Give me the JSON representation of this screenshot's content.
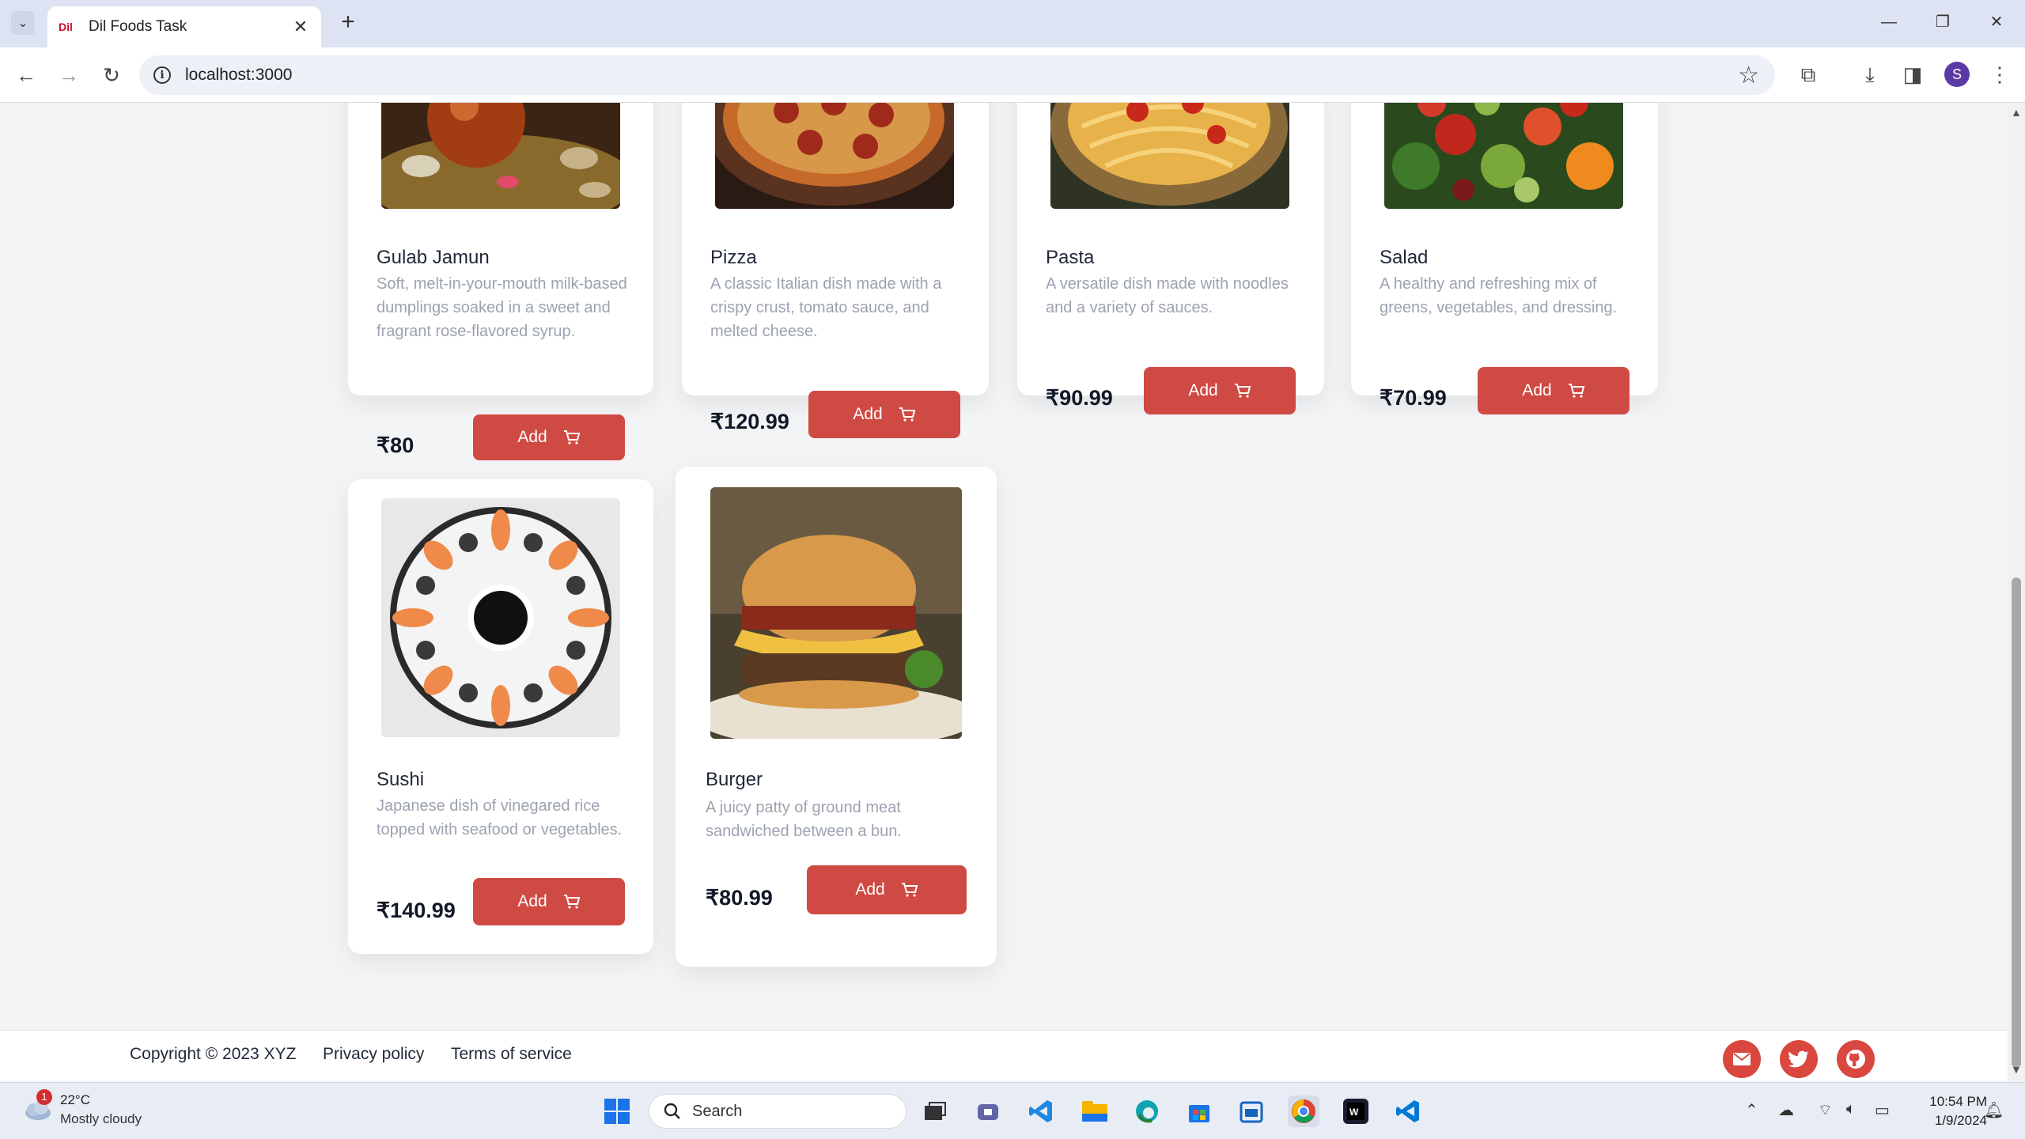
{
  "browser": {
    "tab_title": "Dil Foods Task",
    "favicon_text": "Dil",
    "url": "localhost:3000",
    "profile_initial": "S"
  },
  "products": [
    {
      "name": "Gulab Jamun",
      "description": "Soft, melt-in-your-mouth milk-based dumplings soaked in a sweet and fragrant rose-flavored syrup.",
      "price": "₹80",
      "button": "Add",
      "image": "gulab-jamun-photo"
    },
    {
      "name": "Pizza",
      "description": "A classic Italian dish made with a crispy crust, tomato sauce, and melted cheese.",
      "price": "₹120.99",
      "button": "Add",
      "image": "pizza-photo"
    },
    {
      "name": "Pasta",
      "description": "A versatile dish made with noodles and a variety of sauces.",
      "price": "₹90.99",
      "button": "Add",
      "image": "pasta-photo"
    },
    {
      "name": "Salad",
      "description": "A healthy and refreshing mix of greens, vegetables, and dressing.",
      "price": "₹70.99",
      "button": "Add",
      "image": "salad-photo"
    },
    {
      "name": "Sushi",
      "description": "Japanese dish of vinegared rice topped with seafood or vegetables.",
      "price": "₹140.99",
      "button": "Add",
      "image": "sushi-photo"
    },
    {
      "name": "Burger",
      "description": "A juicy patty of ground meat sandwiched between a bun.",
      "price": "₹80.99",
      "button": "Add",
      "image": "burger-photo"
    }
  ],
  "footer": {
    "copyright": "Copyright © 2023 XYZ",
    "privacy": "Privacy policy",
    "terms": "Terms of service",
    "social": [
      "email-icon",
      "twitter-icon",
      "github-icon"
    ]
  },
  "taskbar": {
    "weather_temp": "22°C",
    "weather_desc": "Mostly cloudy",
    "weather_badge": "1",
    "search_label": "Search",
    "time": "10:54 PM",
    "date": "1/9/2024"
  },
  "colors": {
    "accent": "#cf4a43",
    "page_bg": "#f3f4f6"
  }
}
